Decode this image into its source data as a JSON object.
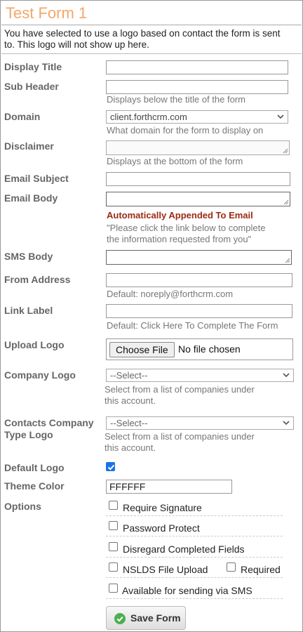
{
  "form": {
    "title": "Test Form 1",
    "notice": "You have selected to use a logo based on contact the form is sent to. This logo will not show up here."
  },
  "fields": {
    "display_title": {
      "label": "Display Title",
      "value": ""
    },
    "sub_header": {
      "label": "Sub Header",
      "value": "",
      "hint": "Displays below the title of the form"
    },
    "domain": {
      "label": "Domain",
      "selected": "client.forthcrm.com",
      "hint": "What domain for the form to display on"
    },
    "disclaimer": {
      "label": "Disclaimer",
      "value": "",
      "hint": "Displays at the bottom of the form"
    },
    "email_subject": {
      "label": "Email Subject",
      "value": ""
    },
    "email_body": {
      "label": "Email Body",
      "value": "",
      "warning": "Automatically Appended To Email",
      "hint_line1": "\"Please click the link below to complete",
      "hint_line2": "the information requested from you\""
    },
    "sms_body": {
      "label": "SMS Body",
      "value": ""
    },
    "from_address": {
      "label": "From Address",
      "value": "",
      "hint": "Default: noreply@forthcrm.com"
    },
    "link_label": {
      "label": "Link Label",
      "value": "",
      "hint": "Default: Click Here To Complete The Form"
    },
    "upload_logo": {
      "label": "Upload Logo",
      "button": "Choose File",
      "file_status": "No file chosen"
    },
    "company_logo": {
      "label": "Company Logo",
      "selected": "--Select--",
      "hint_line1": "Select from a list of companies under",
      "hint_line2": "this account."
    },
    "contacts_company_type_logo": {
      "label_line1": "Contacts Company",
      "label_line2": "Type Logo",
      "selected": "--Select--",
      "hint_line1": "Select from a list of companies under",
      "hint_line2": "this account."
    },
    "default_logo": {
      "label": "Default Logo",
      "checked": true
    },
    "theme_color": {
      "label": "Theme Color",
      "value": "FFFFFF"
    }
  },
  "options": {
    "label": "Options",
    "require_signature": {
      "label": "Require Signature",
      "checked": false
    },
    "password_protect": {
      "label": "Password Protect",
      "checked": false
    },
    "disregard_completed": {
      "label": "Disregard Completed Fields",
      "checked": false
    },
    "nslds_upload": {
      "label": "NSLDS File Upload",
      "checked": false
    },
    "nslds_required": {
      "label": "Required",
      "checked": false
    },
    "sms_available": {
      "label": "Available for sending via SMS",
      "checked": false
    }
  },
  "actions": {
    "save_label": "Save Form"
  },
  "colors": {
    "title": "#f4a76a",
    "warning": "#9b2a12",
    "checkbox_checked": "#1a73e8",
    "save_icon": "#4caf50"
  }
}
